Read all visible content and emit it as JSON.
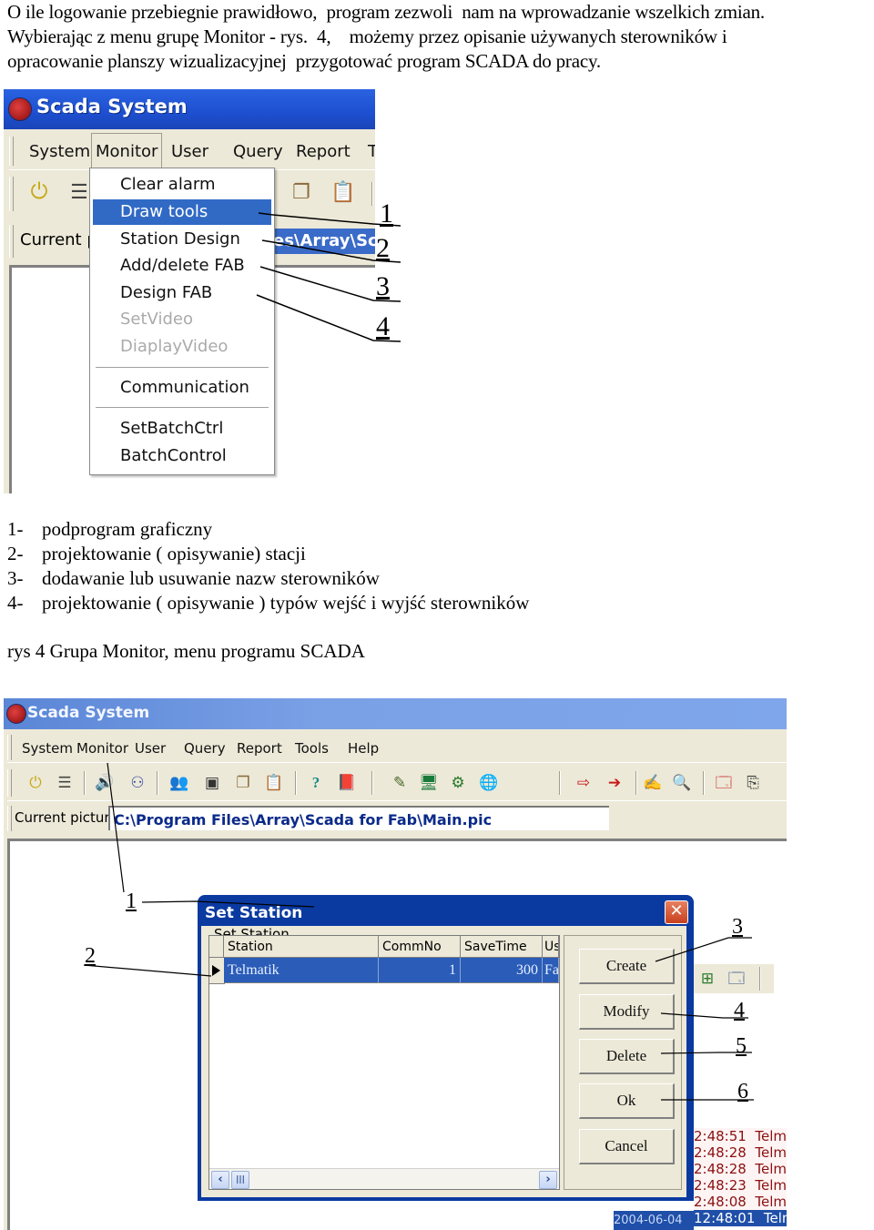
{
  "intro": {
    "lines": [
      "O ile logowanie przebiegnie prawidłowo,  program zezwoli  nam na wprowadzanie wszelkich zmian.",
      "Wybierając z menu grupę Monitor - rys.  4,    możemy przez opisanie używanych sterowników i",
      "opracowanie planszy wizualizacyjnej  przygotować program SCADA do pracy."
    ]
  },
  "figure1": {
    "window_title": "Scada System",
    "menu": [
      "System",
      "Monitor",
      "User",
      "Query",
      "Report",
      "T"
    ],
    "current_picture_label": "Current p",
    "current_picture_value": "es\\Array\\Sc",
    "dropdown": {
      "items": [
        {
          "label": "Clear alarm",
          "state": "normal"
        },
        {
          "label": "Draw tools",
          "state": "highlighted"
        },
        {
          "label": "Station Design",
          "state": "normal"
        },
        {
          "label": "Add/delete FAB",
          "state": "normal"
        },
        {
          "label": "Design FAB",
          "state": "normal"
        },
        {
          "label": "SetVideo",
          "state": "disabled"
        },
        {
          "label": "DiaplayVideo",
          "state": "disabled"
        },
        {
          "label": "Communication",
          "state": "normal"
        },
        {
          "label": "SetBatchCtrl",
          "state": "normal"
        },
        {
          "label": "BatchControl",
          "state": "normal"
        }
      ]
    },
    "callouts": [
      "1",
      "2",
      "3",
      "4"
    ]
  },
  "legend": [
    {
      "num": "1-",
      "text": "podprogram graficzny"
    },
    {
      "num": "2-",
      "text": "projektowanie ( opisywanie) stacji"
    },
    {
      "num": "3-",
      "text": "dodawanie lub usuwanie nazw sterowników"
    },
    {
      "num": "4-",
      "text": "projektowanie ( opisywanie ) typów wejść i wyjść sterowników"
    }
  ],
  "caption": "rys 4 Grupa Monitor, menu programu SCADA",
  "figure2": {
    "window_title": "Scada System",
    "menu": [
      "System",
      "Monitor",
      "User",
      "Query",
      "Report",
      "Tools",
      "Help"
    ],
    "toolbar_icons": [
      "power-icon",
      "list-icon",
      "speaker-icon",
      "network-icon",
      "users-icon",
      "camera-icon",
      "windows-icon",
      "clipboard-icon",
      "help-icon",
      "book-icon",
      "pen-icon",
      "monitor-icon",
      "robot-icon",
      "globe-icon",
      "export-icon",
      "arrow-right-icon",
      "edit-icon",
      "search-icon",
      "window-icon",
      "copy-icon"
    ],
    "current_picture_label": "Current picture",
    "current_picture_value": "C:\\Program Files\\Array\\Scada for Fab\\Main.pic",
    "dialog": {
      "title": "Set Station",
      "group_label": "Set Station",
      "columns": [
        "Station",
        "CommNo",
        "SaveTime",
        "Us"
      ],
      "rows": [
        {
          "station": "Telmatik",
          "commno": "1",
          "savetime": "300",
          "us": "Fa"
        }
      ],
      "buttons": [
        "Create",
        "Modify",
        "Delete",
        "Ok",
        "Cancel"
      ]
    },
    "alarm_list": [
      {
        "time": "2:48:51",
        "name": "Telma"
      },
      {
        "time": "2:48:28",
        "name": "Telma"
      },
      {
        "time": "2:48:28",
        "name": "Telma"
      },
      {
        "time": "2:48:23",
        "name": "Telma"
      },
      {
        "time": "2:48:08",
        "name": "Telma"
      },
      {
        "date": "2004-06-04",
        "time": "12:48:01",
        "name": "Telma"
      }
    ],
    "callouts": [
      "1",
      "2",
      "3",
      "4",
      "5",
      "6"
    ]
  },
  "colors": {
    "titlebar": "#1d4fd0",
    "menu_highlight": "#316ac5",
    "window_bg": "#ece9d8",
    "path_text": "#0a2a8a",
    "alarm_text": "#8a1010"
  }
}
